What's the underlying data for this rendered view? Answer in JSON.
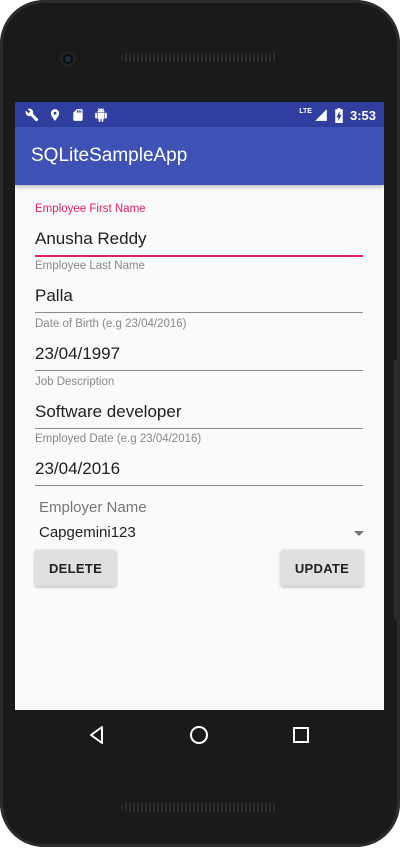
{
  "status_bar": {
    "icons_left": [
      "wrench-icon",
      "location-icon",
      "sd-card-icon",
      "android-icon"
    ],
    "network_label": "LTE",
    "time": "3:53"
  },
  "app_bar": {
    "title": "SQLiteSampleApp"
  },
  "form": {
    "first_name": {
      "label": "Employee First Name",
      "value": "Anusha Reddy"
    },
    "last_name": {
      "label": "Employee Last Name",
      "value": "Palla"
    },
    "dob": {
      "label": "Date of Birth (e.g 23/04/2016)",
      "value": "23/04/1997"
    },
    "job": {
      "label": "Job Description",
      "value": "Software developer"
    },
    "employed": {
      "label": "Employed Date (e.g 23/04/2016)",
      "value": "23/04/2016"
    },
    "employer": {
      "label": "Employer Name",
      "value": "Capgemini123"
    }
  },
  "buttons": {
    "delete": "DELETE",
    "update": "UPDATE"
  },
  "navigation": [
    "back-icon",
    "home-icon",
    "recents-icon"
  ],
  "colors": {
    "primary": "#3F51B5",
    "primary_dark": "#303F9F",
    "accent": "#E91E63"
  }
}
